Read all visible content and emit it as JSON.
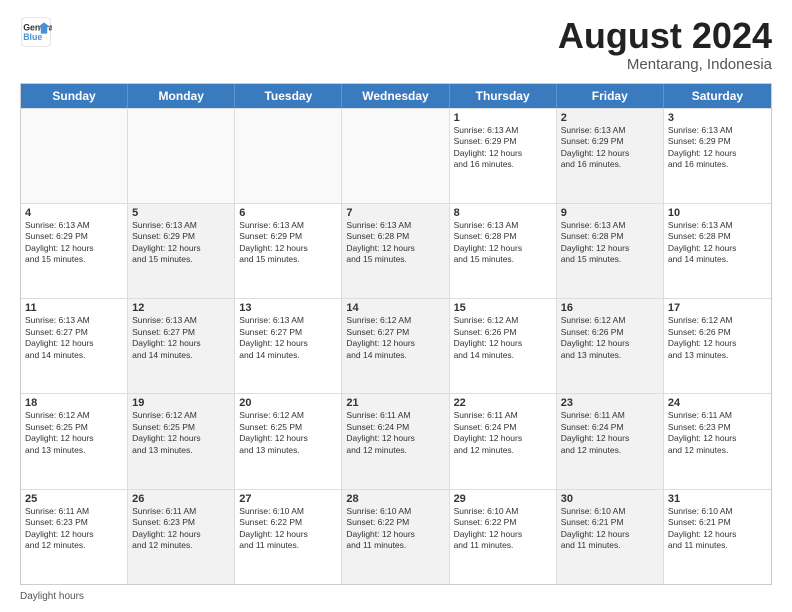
{
  "logo": {
    "line1": "General",
    "line2": "Blue"
  },
  "title": "August 2024",
  "location": "Mentarang, Indonesia",
  "days_of_week": [
    "Sunday",
    "Monday",
    "Tuesday",
    "Wednesday",
    "Thursday",
    "Friday",
    "Saturday"
  ],
  "footer_label": "Daylight hours",
  "weeks": [
    [
      {
        "day": "",
        "detail": "",
        "empty": true
      },
      {
        "day": "",
        "detail": "",
        "empty": true
      },
      {
        "day": "",
        "detail": "",
        "empty": true
      },
      {
        "day": "",
        "detail": "",
        "empty": true
      },
      {
        "day": "1",
        "detail": "Sunrise: 6:13 AM\nSunset: 6:29 PM\nDaylight: 12 hours\nand 16 minutes.",
        "empty": false,
        "shaded": false
      },
      {
        "day": "2",
        "detail": "Sunrise: 6:13 AM\nSunset: 6:29 PM\nDaylight: 12 hours\nand 16 minutes.",
        "empty": false,
        "shaded": true
      },
      {
        "day": "3",
        "detail": "Sunrise: 6:13 AM\nSunset: 6:29 PM\nDaylight: 12 hours\nand 16 minutes.",
        "empty": false,
        "shaded": false
      }
    ],
    [
      {
        "day": "4",
        "detail": "Sunrise: 6:13 AM\nSunset: 6:29 PM\nDaylight: 12 hours\nand 15 minutes.",
        "empty": false,
        "shaded": false
      },
      {
        "day": "5",
        "detail": "Sunrise: 6:13 AM\nSunset: 6:29 PM\nDaylight: 12 hours\nand 15 minutes.",
        "empty": false,
        "shaded": true
      },
      {
        "day": "6",
        "detail": "Sunrise: 6:13 AM\nSunset: 6:29 PM\nDaylight: 12 hours\nand 15 minutes.",
        "empty": false,
        "shaded": false
      },
      {
        "day": "7",
        "detail": "Sunrise: 6:13 AM\nSunset: 6:28 PM\nDaylight: 12 hours\nand 15 minutes.",
        "empty": false,
        "shaded": true
      },
      {
        "day": "8",
        "detail": "Sunrise: 6:13 AM\nSunset: 6:28 PM\nDaylight: 12 hours\nand 15 minutes.",
        "empty": false,
        "shaded": false
      },
      {
        "day": "9",
        "detail": "Sunrise: 6:13 AM\nSunset: 6:28 PM\nDaylight: 12 hours\nand 15 minutes.",
        "empty": false,
        "shaded": true
      },
      {
        "day": "10",
        "detail": "Sunrise: 6:13 AM\nSunset: 6:28 PM\nDaylight: 12 hours\nand 14 minutes.",
        "empty": false,
        "shaded": false
      }
    ],
    [
      {
        "day": "11",
        "detail": "Sunrise: 6:13 AM\nSunset: 6:27 PM\nDaylight: 12 hours\nand 14 minutes.",
        "empty": false,
        "shaded": false
      },
      {
        "day": "12",
        "detail": "Sunrise: 6:13 AM\nSunset: 6:27 PM\nDaylight: 12 hours\nand 14 minutes.",
        "empty": false,
        "shaded": true
      },
      {
        "day": "13",
        "detail": "Sunrise: 6:13 AM\nSunset: 6:27 PM\nDaylight: 12 hours\nand 14 minutes.",
        "empty": false,
        "shaded": false
      },
      {
        "day": "14",
        "detail": "Sunrise: 6:12 AM\nSunset: 6:27 PM\nDaylight: 12 hours\nand 14 minutes.",
        "empty": false,
        "shaded": true
      },
      {
        "day": "15",
        "detail": "Sunrise: 6:12 AM\nSunset: 6:26 PM\nDaylight: 12 hours\nand 14 minutes.",
        "empty": false,
        "shaded": false
      },
      {
        "day": "16",
        "detail": "Sunrise: 6:12 AM\nSunset: 6:26 PM\nDaylight: 12 hours\nand 13 minutes.",
        "empty": false,
        "shaded": true
      },
      {
        "day": "17",
        "detail": "Sunrise: 6:12 AM\nSunset: 6:26 PM\nDaylight: 12 hours\nand 13 minutes.",
        "empty": false,
        "shaded": false
      }
    ],
    [
      {
        "day": "18",
        "detail": "Sunrise: 6:12 AM\nSunset: 6:25 PM\nDaylight: 12 hours\nand 13 minutes.",
        "empty": false,
        "shaded": false
      },
      {
        "day": "19",
        "detail": "Sunrise: 6:12 AM\nSunset: 6:25 PM\nDaylight: 12 hours\nand 13 minutes.",
        "empty": false,
        "shaded": true
      },
      {
        "day": "20",
        "detail": "Sunrise: 6:12 AM\nSunset: 6:25 PM\nDaylight: 12 hours\nand 13 minutes.",
        "empty": false,
        "shaded": false
      },
      {
        "day": "21",
        "detail": "Sunrise: 6:11 AM\nSunset: 6:24 PM\nDaylight: 12 hours\nand 12 minutes.",
        "empty": false,
        "shaded": true
      },
      {
        "day": "22",
        "detail": "Sunrise: 6:11 AM\nSunset: 6:24 PM\nDaylight: 12 hours\nand 12 minutes.",
        "empty": false,
        "shaded": false
      },
      {
        "day": "23",
        "detail": "Sunrise: 6:11 AM\nSunset: 6:24 PM\nDaylight: 12 hours\nand 12 minutes.",
        "empty": false,
        "shaded": true
      },
      {
        "day": "24",
        "detail": "Sunrise: 6:11 AM\nSunset: 6:23 PM\nDaylight: 12 hours\nand 12 minutes.",
        "empty": false,
        "shaded": false
      }
    ],
    [
      {
        "day": "25",
        "detail": "Sunrise: 6:11 AM\nSunset: 6:23 PM\nDaylight: 12 hours\nand 12 minutes.",
        "empty": false,
        "shaded": false
      },
      {
        "day": "26",
        "detail": "Sunrise: 6:11 AM\nSunset: 6:23 PM\nDaylight: 12 hours\nand 12 minutes.",
        "empty": false,
        "shaded": true
      },
      {
        "day": "27",
        "detail": "Sunrise: 6:10 AM\nSunset: 6:22 PM\nDaylight: 12 hours\nand 11 minutes.",
        "empty": false,
        "shaded": false
      },
      {
        "day": "28",
        "detail": "Sunrise: 6:10 AM\nSunset: 6:22 PM\nDaylight: 12 hours\nand 11 minutes.",
        "empty": false,
        "shaded": true
      },
      {
        "day": "29",
        "detail": "Sunrise: 6:10 AM\nSunset: 6:22 PM\nDaylight: 12 hours\nand 11 minutes.",
        "empty": false,
        "shaded": false
      },
      {
        "day": "30",
        "detail": "Sunrise: 6:10 AM\nSunset: 6:21 PM\nDaylight: 12 hours\nand 11 minutes.",
        "empty": false,
        "shaded": true
      },
      {
        "day": "31",
        "detail": "Sunrise: 6:10 AM\nSunset: 6:21 PM\nDaylight: 12 hours\nand 11 minutes.",
        "empty": false,
        "shaded": false
      }
    ]
  ]
}
